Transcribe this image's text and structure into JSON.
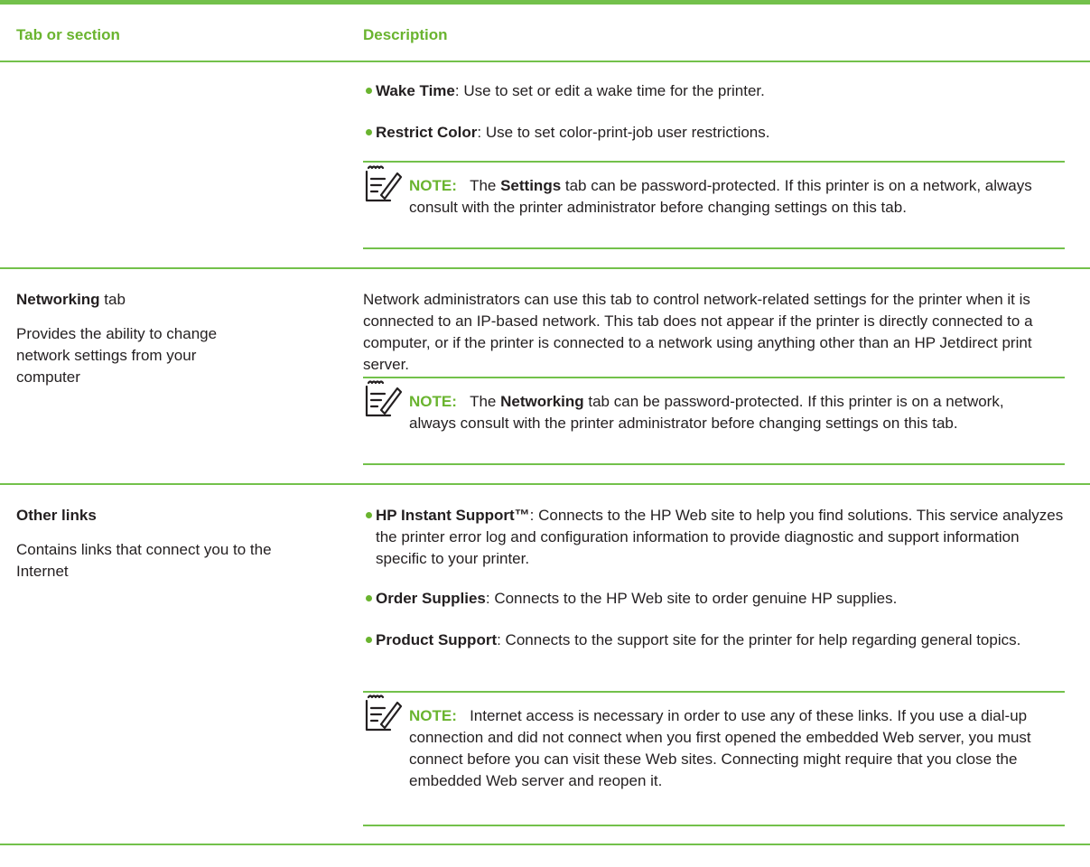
{
  "header": {
    "col1": "Tab or section",
    "col2": "Description"
  },
  "settings_section": {
    "bullets": [
      {
        "bold": "Wake Time",
        "text": ": Use to set or edit a wake time for the printer."
      },
      {
        "bold": "Restrict Color",
        "text": ": Use to set color-print-job user restrictions."
      }
    ],
    "note": {
      "label": "NOTE:",
      "pre": "The ",
      "bold": "Settings",
      "post": " tab can be password-protected. If this printer is on a network, always consult with the printer administrator before changing settings on this tab."
    }
  },
  "networking_section": {
    "title_bold": "Networking",
    "title_rest": " tab",
    "subtitle": "Provides the ability to change network settings from your computer",
    "description": "Network administrators can use this tab to control network-related settings for the printer when it is connected to an IP-based network. This tab does not appear if the printer is directly connected to a computer, or if the printer is connected to a network using anything other than an HP Jetdirect print server.",
    "note": {
      "label": "NOTE:",
      "pre": "The ",
      "bold": "Networking",
      "post": " tab can be password-protected. If this printer is on a network, always consult with the printer administrator before changing settings on this tab."
    }
  },
  "other_links_section": {
    "title": "Other links",
    "subtitle": "Contains links that connect you to the Internet",
    "bullets": [
      {
        "bold": "HP Instant Support™",
        "text": ": Connects to the HP Web site to help you find solutions. This service analyzes the printer error log and configuration information to provide diagnostic and support information specific to your printer."
      },
      {
        "bold": "Order Supplies",
        "text": ": Connects to the HP Web site to order genuine HP supplies."
      },
      {
        "bold": "Product Support",
        "text": ": Connects to the support site for the printer for help regarding general topics."
      }
    ],
    "note": {
      "label": "NOTE:",
      "text": "Internet access is necessary in order to use any of these links. If you use a dial-up connection and did not connect when you first opened the embedded Web server, you must connect before you can visit these Web sites. Connecting might require that you close the embedded Web server and reopen it."
    },
    "icon": "note-pencil-icon"
  },
  "colors": {
    "accent": "#6ab42f",
    "rule": "#73c14b",
    "text": "#231f20"
  }
}
